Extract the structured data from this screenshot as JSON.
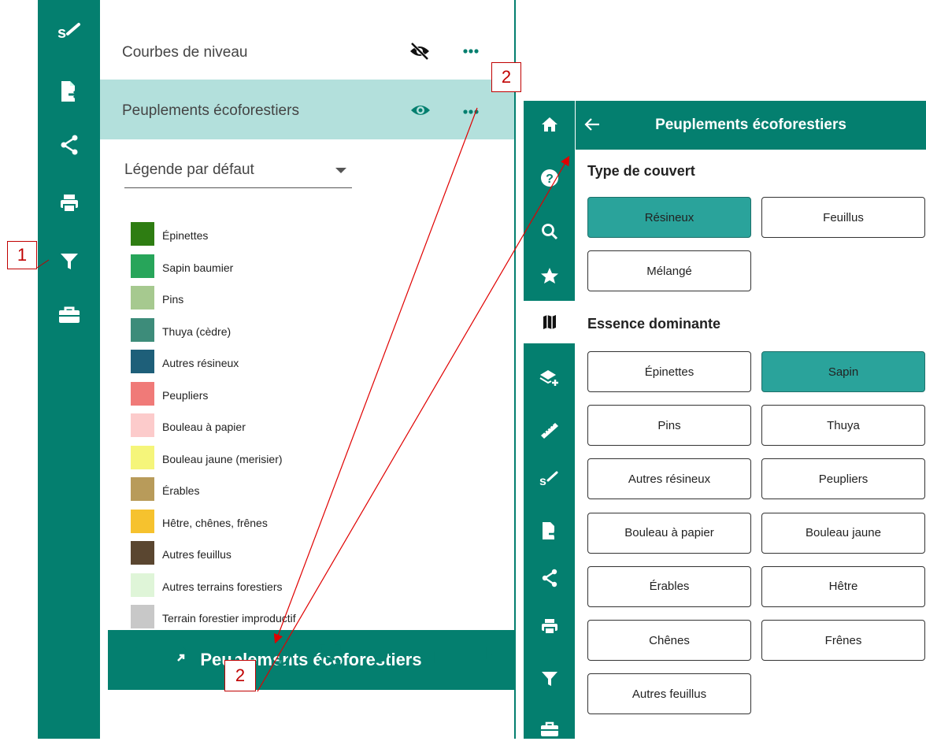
{
  "left_panel": {
    "rail_icons": [
      "measure-icon",
      "export-file-icon",
      "share-icon",
      "print-icon",
      "filter-icon",
      "toolbox-icon"
    ],
    "layers": [
      {
        "name": "Courbes de niveau",
        "visibility": "hidden"
      },
      {
        "name": "Peuplements écoforestiers",
        "visibility": "visible",
        "selected": true
      }
    ],
    "legend_dropdown": {
      "value": "Légende par défaut"
    },
    "legend": [
      {
        "label": "Épinettes",
        "color": "#2e7d12"
      },
      {
        "label": "Sapin baumier",
        "color": "#27a55a"
      },
      {
        "label": "Pins",
        "color": "#a6c98f"
      },
      {
        "label": "Thuya (cèdre)",
        "color": "#3d8c7a"
      },
      {
        "label": "Autres résineux",
        "color": "#1e5f79"
      },
      {
        "label": "Peupliers",
        "color": "#f07a78"
      },
      {
        "label": "Bouleau à papier",
        "color": "#fccbcb"
      },
      {
        "label": "Bouleau jaune (merisier)",
        "color": "#f5f57a"
      },
      {
        "label": "Érables",
        "color": "#b89b5a"
      },
      {
        "label": "Hêtre, chênes, frênes",
        "color": "#f6c22e"
      },
      {
        "label": "Autres feuillus",
        "color": "#5a4630"
      },
      {
        "label": "Autres terrains forestiers",
        "color": "#dff5d8"
      },
      {
        "label": "Terrain forestier improductif",
        "color": "#c8c8c8"
      }
    ],
    "banner_title": "Peuplements écoforestiers",
    "toolbar_icons": [
      "table-icon",
      "export-icon",
      "filter-icon",
      "info-icon",
      "zoom-to-extent-icon",
      "opacity-icon",
      "move-up-icon",
      "move-down-icon"
    ]
  },
  "right_panel": {
    "title": "Peuplements écoforestiers",
    "rail_icons": [
      "home-icon",
      "help-icon",
      "search-icon",
      "favorite-icon",
      "map-icon",
      "add-layer-icon",
      "ruler-icon",
      "measure-icon",
      "export-file-icon",
      "share-icon",
      "print-icon",
      "filter-icon",
      "toolbox-icon"
    ],
    "sections": [
      {
        "title": "Type de couvert",
        "buttons": [
          {
            "label": "Résineux",
            "selected": true
          },
          {
            "label": "Feuillus",
            "selected": false
          },
          {
            "label": "Mélangé",
            "selected": false
          }
        ]
      },
      {
        "title": "Essence dominante",
        "buttons": [
          {
            "label": "Épinettes",
            "selected": false
          },
          {
            "label": "Sapin",
            "selected": true
          },
          {
            "label": "Pins",
            "selected": false
          },
          {
            "label": "Thuya",
            "selected": false
          },
          {
            "label": "Autres résineux",
            "selected": false
          },
          {
            "label": "Peupliers",
            "selected": false
          },
          {
            "label": "Bouleau à papier",
            "selected": false
          },
          {
            "label": "Bouleau jaune",
            "selected": false
          },
          {
            "label": "Érables",
            "selected": false
          },
          {
            "label": "Hêtre",
            "selected": false
          },
          {
            "label": "Chênes",
            "selected": false
          },
          {
            "label": "Frênes",
            "selected": false
          },
          {
            "label": "Autres feuillus",
            "selected": false
          }
        ]
      }
    ]
  },
  "annotations": {
    "step1": "1",
    "step2_top": "2",
    "step2_bottom": "2"
  },
  "colors": {
    "teal": "#047f6f",
    "selected_row": "#b3e0dc",
    "selected_button": "#2aa39b",
    "annotation": "#c00000"
  }
}
